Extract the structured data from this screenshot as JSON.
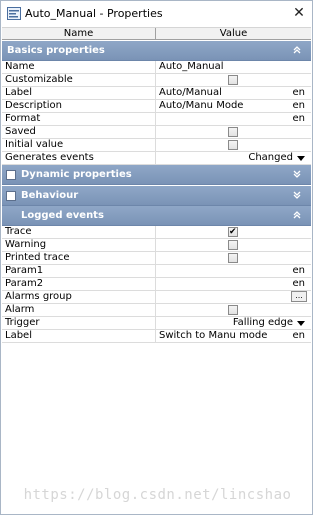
{
  "window": {
    "title": "Auto_Manual - Properties",
    "close_glyph": "✕"
  },
  "columns": {
    "name": "Name",
    "value": "Value"
  },
  "sections": {
    "basics": {
      "label": "Basics properties",
      "rows": [
        {
          "name": "Name",
          "value": "Auto_Manual"
        },
        {
          "name": "Customizable",
          "checkbox": false
        },
        {
          "name": "Label",
          "value": "Auto/Manual",
          "lang": "en"
        },
        {
          "name": "Description",
          "value": "Auto/Manu Mode",
          "lang": "en"
        },
        {
          "name": "Format",
          "value": "",
          "lang": "en"
        },
        {
          "name": "Saved",
          "checkbox": false
        },
        {
          "name": "Initial value",
          "checkbox": false
        },
        {
          "name": "Generates events",
          "dropdown": "Changed"
        }
      ]
    },
    "dynamic": {
      "label": "Dynamic properties"
    },
    "behaviour": {
      "label": "Behaviour"
    },
    "logged": {
      "label": "Logged events",
      "rows": [
        {
          "name": "Trace",
          "checkbox": true
        },
        {
          "name": "Warning",
          "checkbox": false
        },
        {
          "name": "Printed trace",
          "checkbox": false
        },
        {
          "name": "Param1",
          "value": "",
          "lang": "en"
        },
        {
          "name": "Param2",
          "value": "",
          "lang": "en"
        },
        {
          "name": "Alarms group",
          "button": "..."
        },
        {
          "name": "Alarm",
          "checkbox": false
        },
        {
          "name": "Trigger",
          "dropdown": "Falling edge"
        },
        {
          "name": "Label",
          "value": "Switch to Manu mode",
          "lang": "en"
        }
      ]
    }
  },
  "watermark": "https://blog.csdn.net/lincshao",
  "colors": {
    "section_bg": "#8fa7c7",
    "section_text": "#ffffff",
    "grid_line": "#dcdcdc"
  }
}
